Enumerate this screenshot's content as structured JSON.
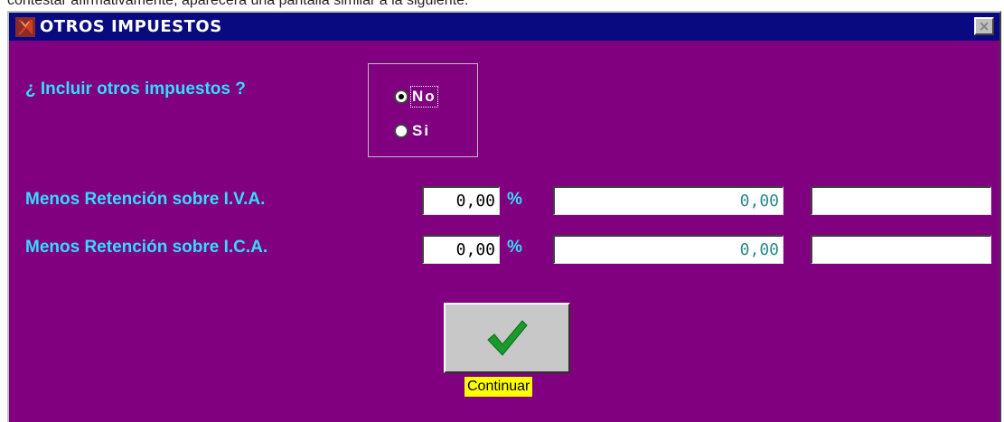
{
  "caption": "contestar afirmativamente, aparecerá una pantalla similar a la siguiente:",
  "window": {
    "title": "OTROS IMPUESTOS",
    "icons": {
      "app": "app-icon",
      "close": "close-icon"
    },
    "close_label": "×"
  },
  "question": {
    "label": "¿ Incluir otros impuestos ?",
    "options": [
      {
        "label": "No",
        "checked": true,
        "focused": true
      },
      {
        "label": "Si",
        "checked": false,
        "focused": false
      }
    ]
  },
  "rows": [
    {
      "label": "Menos Retención sobre I.V.A.",
      "percent": "0,00",
      "percent_sign": "%",
      "value": "0,00",
      "extra": ""
    },
    {
      "label": "Menos Retención sobre I.C.A.",
      "percent": "0,00",
      "percent_sign": "%",
      "value": "0,00",
      "extra": ""
    }
  ],
  "continue_button": {
    "label": "Continuar",
    "icon": "checkmark-icon"
  },
  "colors": {
    "window_bg": "#800080",
    "titlebar_bg": "#0a0a80",
    "label_color": "#33ddff",
    "value_color": "#2a8a8a",
    "checkmark": "#1a9a2a",
    "continue_label_bg": "#ffff00"
  }
}
